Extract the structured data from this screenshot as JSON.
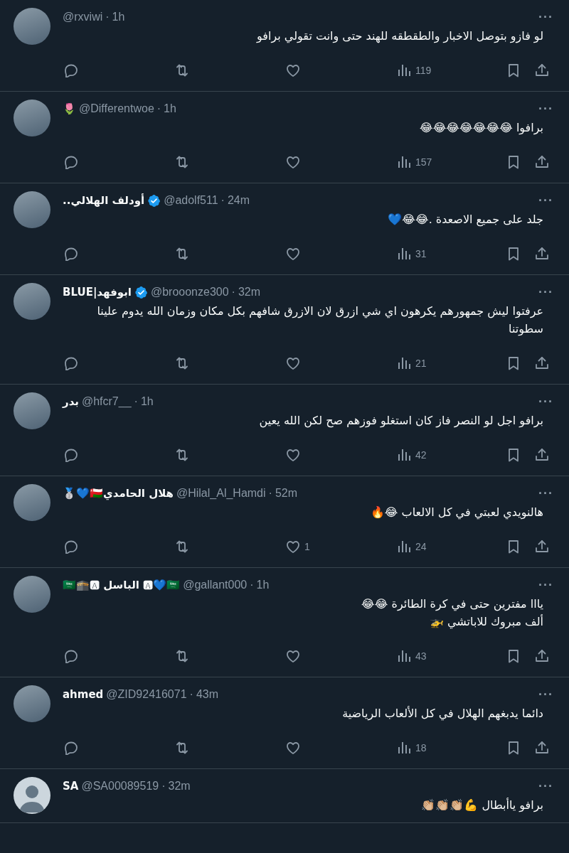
{
  "tweets": [
    {
      "default_avatar": false,
      "verified": false,
      "handle": "@rxviwi",
      "separator": "·",
      "time": "1h",
      "text": "لو فازو بتوصل الاخبار والطقطقه للهند حتى وانت تقولي برافو",
      "more": "···",
      "stats": {
        "views": "119"
      }
    },
    {
      "default_avatar": false,
      "name": "🌷",
      "verified": false,
      "handle": "@Differentwoe",
      "separator": "·",
      "time": "1h",
      "text": "برافوا 😂😂😂😂😂😂😂",
      "more": "···",
      "stats": {
        "views": "157"
      }
    },
    {
      "default_avatar": false,
      "name": "أودلف الهلالي..",
      "verified": true,
      "handle": "@adolf511",
      "separator": "·",
      "time": "24m",
      "text": "جلد على جميع الاصعدة .😂😂💙",
      "more": "···",
      "stats": {
        "views": "31"
      }
    },
    {
      "default_avatar": false,
      "name": "ابوفهد|BLUE",
      "verified": true,
      "handle": "@brooonze300",
      "separator": "·",
      "time": "32m",
      "text": "عرفتوا ليش جمهورهم يكرهون اي شي ازرق لان الازرق شافهم بكل مكان وزمان الله يدوم علينا سطوتنا",
      "more": "···",
      "stats": {
        "views": "21"
      }
    },
    {
      "default_avatar": false,
      "name": "بدر",
      "verified": false,
      "handle": "@hfcr7__",
      "separator": "·",
      "time": "1h",
      "text": "برافو اجل لو النصر فاز كان استغلو فوزهم صح لكن الله يعين",
      "more": "···",
      "stats": {
        "views": "42"
      }
    },
    {
      "default_avatar": false,
      "name": "🥈💙🇴🇲هلال الحامدي",
      "verified": false,
      "handle": "@Hilal_Al_Hamdi",
      "separator": "·",
      "time": "52m",
      "text": "هالنويدي لعبتي في كل الالعاب 😂🔥",
      "more": "···",
      "stats": {
        "likes": "1",
        "views": "24"
      }
    },
    {
      "default_avatar": false,
      "name": "🇸🇦🕋🅰 الباسل 🅰💙🇸🇦",
      "verified": false,
      "handle": "@gallant000",
      "separator": "·",
      "time": "1h",
      "text": "يااا مفترين حتى في كرة الطائرة 😂😂\nألف مبروك للاباتشي 🚁",
      "more": "···",
      "stats": {
        "views": "43"
      }
    },
    {
      "default_avatar": false,
      "name": "ahmed",
      "verified": false,
      "handle": "@ZID92416071",
      "separator": "·",
      "time": "43m",
      "text": "دائما يدبغهم الهلال في كل الألعاب الرياضية",
      "more": "···",
      "stats": {
        "views": "18"
      }
    },
    {
      "default_avatar": true,
      "name": "SA",
      "verified": false,
      "handle": "@SA00089519",
      "separator": "·",
      "time": "32m",
      "text": "برافو ياأبطال 💪👏🏼👏🏼👏🏼",
      "more": "···"
    }
  ]
}
